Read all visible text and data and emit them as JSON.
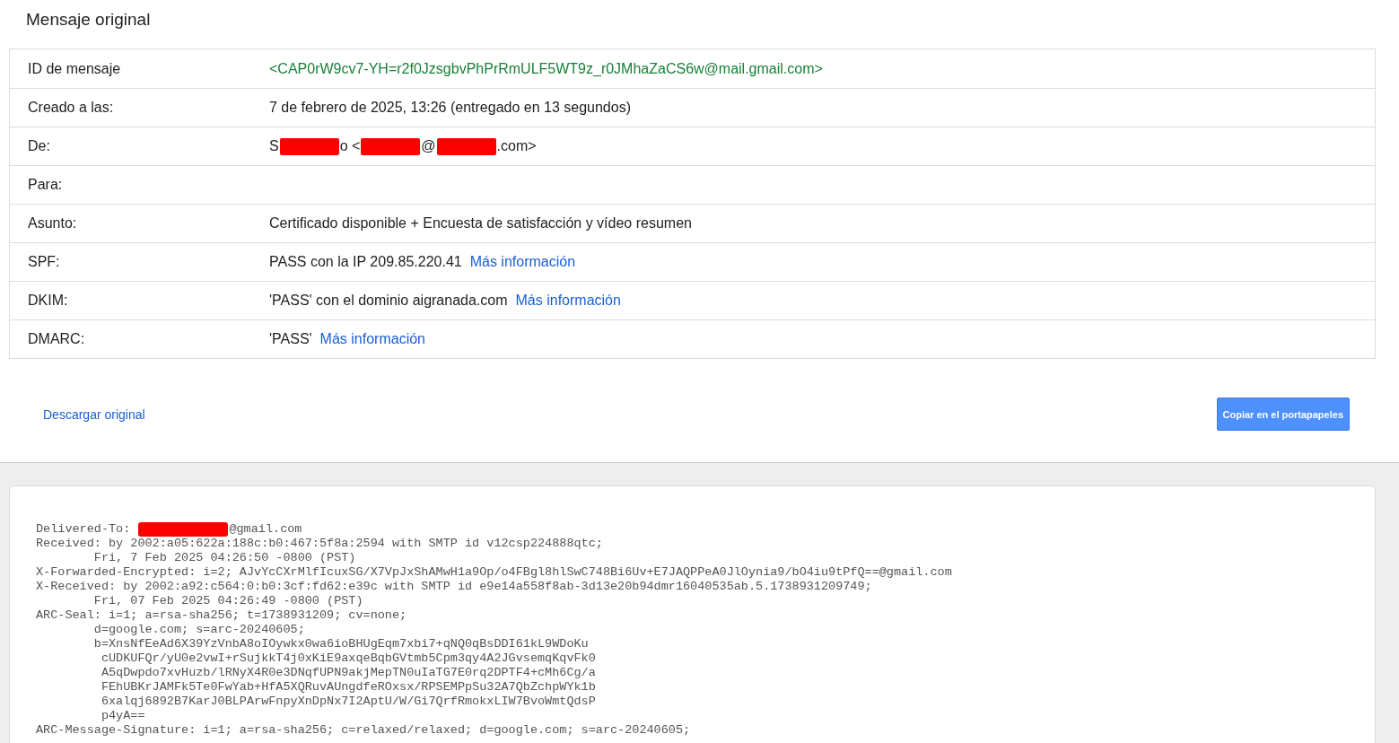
{
  "title": "Mensaje original",
  "details": [
    {
      "label": "ID de mensaje",
      "kind": "id",
      "parts": [
        {
          "kind": "text",
          "text": "<CAP0rW9cv7-YH=r2f0JzsgbvPhPrRmULF5WT9z_r0JMhaZaCS6w@mail.gmail.com>"
        }
      ]
    },
    {
      "label": "Creado a las:",
      "kind": "plain",
      "parts": [
        {
          "kind": "text",
          "text": "7 de febrero de 2025, 13:26 (entregado en 13 segundos)"
        }
      ]
    },
    {
      "label": "De:",
      "kind": "plain",
      "parts": [
        {
          "kind": "text",
          "text": "S"
        },
        {
          "kind": "redaction"
        },
        {
          "kind": "text",
          "text": "o <"
        },
        {
          "kind": "redaction"
        },
        {
          "kind": "text",
          "text": "@"
        },
        {
          "kind": "redaction"
        },
        {
          "kind": "text",
          "text": ".com>"
        }
      ]
    },
    {
      "label": "Para:"
    },
    {
      "label": "Asunto:",
      "kind": "plain",
      "parts": [
        {
          "kind": "text",
          "text": "Certificado disponible + Encuesta de satisfacción y vídeo resumen"
        }
      ]
    },
    {
      "label": "SPF:",
      "kind": "plain",
      "parts": [
        {
          "kind": "text",
          "text": "PASS con la IP 209.85.220.41"
        },
        {
          "kind": "link",
          "text": "Más información"
        }
      ]
    },
    {
      "label": "DKIM:",
      "kind": "plain",
      "parts": [
        {
          "kind": "text",
          "text": "'PASS' con el dominio aigranada.com"
        },
        {
          "kind": "link",
          "text": "Más información"
        }
      ]
    },
    {
      "label": "DMARC:",
      "kind": "plain",
      "parts": [
        {
          "kind": "text",
          "text": "'PASS'"
        },
        {
          "kind": "link",
          "text": "Más información"
        }
      ]
    }
  ],
  "download_link": "Descargar original",
  "copy_button": "Copiar en el portapapeles",
  "raw_lines": [
    [
      {
        "kind": "text",
        "text": "Delivered-To: "
      },
      {
        "kind": "redaction"
      },
      {
        "kind": "text",
        "text": "@gmail.com"
      }
    ],
    [
      {
        "kind": "text",
        "text": "Received: by 2002:a05:622a:188c:b0:467:5f8a:2594 with SMTP id v12csp224888qtc;"
      }
    ],
    [
      {
        "kind": "text",
        "text": "        Fri, 7 Feb 2025 04:26:50 -0800 (PST)"
      }
    ],
    [
      {
        "kind": "text",
        "text": "X-Forwarded-Encrypted: i=2; AJvYcCXrMlfIcuxSG/X7VpJxShAMwH1a9Op/o4FBgl8hlSwC748Bi6Uv+E7JAQPPeA0JlOynia9/bO4iu9tPfQ==@gmail.com"
      }
    ],
    [
      {
        "kind": "text",
        "text": "X-Received: by 2002:a92:c564:0:b0:3cf:fd62:e39c with SMTP id e9e14a558f8ab-3d13e20b94dmr16040535ab.5.1738931209749;"
      }
    ],
    [
      {
        "kind": "text",
        "text": "        Fri, 07 Feb 2025 04:26:49 -0800 (PST)"
      }
    ],
    [
      {
        "kind": "text",
        "text": "ARC-Seal: i=1; a=rsa-sha256; t=1738931209; cv=none;"
      }
    ],
    [
      {
        "kind": "text",
        "text": "        d=google.com; s=arc-20240605;"
      }
    ],
    [
      {
        "kind": "text",
        "text": "        b=XnsNfEeAd6X39YzVnbA8oIOywkx0wa6ioBHUgEqm7xbi7+qNQ0qBsDDI61kL9WDoKu"
      }
    ],
    [
      {
        "kind": "text",
        "text": "         cUDKUFQr/yU0e2vwI+rSujkkT4j0xKiE9axqeBqbGVtmb5Cpm3qy4A2JGvsemqKqvFk0"
      }
    ],
    [
      {
        "kind": "text",
        "text": "         A5qDwpdo7xvHuzb/lRNyX4R0e3DNqfUPN9akjMepTN0uIaTG7E0rq2DPTF4+cMh6Cg/a"
      }
    ],
    [
      {
        "kind": "text",
        "text": "         FEhUBKrJAMFk5Te0FwYab+HfA5XQRuvAUngdfeROxsx/RPSEMPpSu32A7QbZchpWYk1b"
      }
    ],
    [
      {
        "kind": "text",
        "text": "         6xalqj6892B7KarJ0BLPArwFnpyXnDpNx7I2AptU/W/Gi7QrfRmokxLIW7BvoWmtQdsP"
      }
    ],
    [
      {
        "kind": "text",
        "text": "         p4yA=="
      }
    ],
    [
      {
        "kind": "text",
        "text": "ARC-Message-Signature: i=1; a=rsa-sha256; c=relaxed/relaxed; d=google.com; s=arc-20240605;"
      }
    ]
  ]
}
